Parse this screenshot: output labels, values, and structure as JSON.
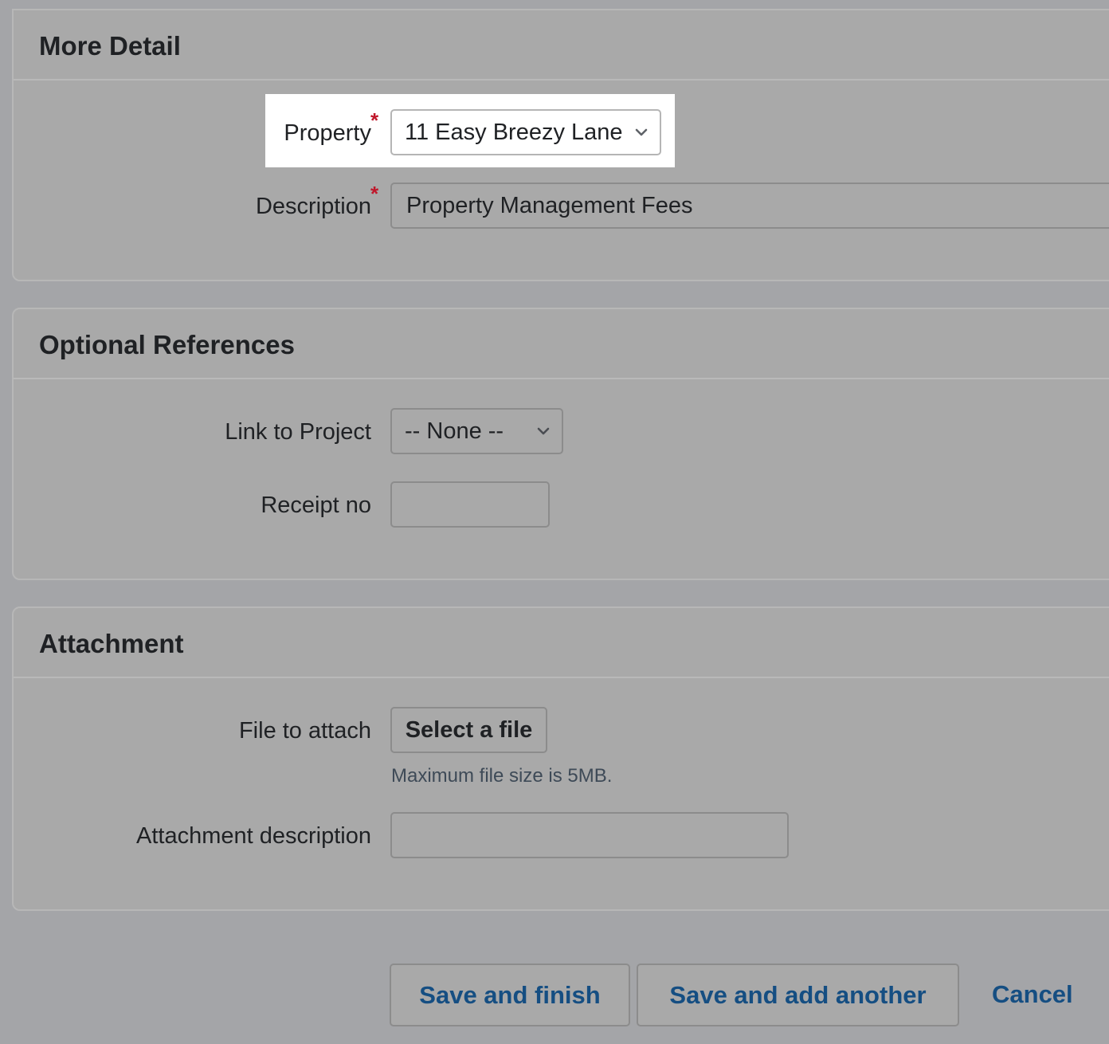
{
  "more_detail": {
    "title": "More Detail",
    "property": {
      "label": "Property",
      "required_mark": "*",
      "value": "11 Easy Breezy Lane"
    },
    "description": {
      "label": "Description",
      "required_mark": "*",
      "value": "Property Management Fees"
    }
  },
  "optional_references": {
    "title": "Optional References",
    "link_to_project": {
      "label": "Link to Project",
      "value": "-- None --"
    },
    "receipt_no": {
      "label": "Receipt no",
      "value": ""
    }
  },
  "attachment": {
    "title": "Attachment",
    "file_to_attach": {
      "label": "File to attach",
      "button_label": "Select a file",
      "helper": "Maximum file size is 5MB."
    },
    "attachment_description": {
      "label": "Attachment description",
      "value": ""
    }
  },
  "actions": {
    "save_finish": "Save and finish",
    "save_add_another": "Save and add another",
    "cancel": "Cancel"
  },
  "icons": {
    "select_chevron": "chevron-down-icon"
  },
  "colors": {
    "required": "#c0172b",
    "action_text": "#154e82",
    "highlight_bg": "#ffffff"
  }
}
